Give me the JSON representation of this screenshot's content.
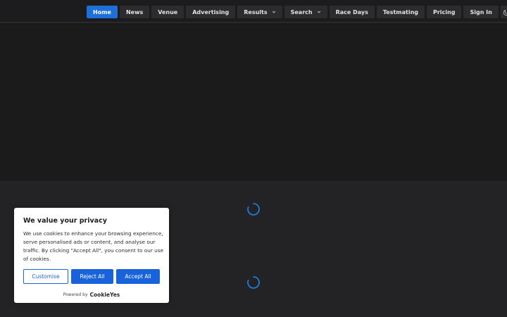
{
  "nav": {
    "items": [
      {
        "label": "Home",
        "active": true
      },
      {
        "label": "News"
      },
      {
        "label": "Venue"
      },
      {
        "label": "Advertising"
      },
      {
        "label": "Results",
        "dropdown": true
      },
      {
        "label": "Search",
        "dropdown": true
      },
      {
        "label": "Race Days"
      },
      {
        "label": "Testmating"
      },
      {
        "label": "Pricing"
      },
      {
        "label": "Sign In"
      }
    ],
    "theme_toggle_icon": "moon-icon",
    "dropdown_icon": "chevron-down-icon"
  },
  "loaders": {
    "icon": "spinner-icon",
    "color": "#1e7be0"
  },
  "cookie": {
    "title": "We value your privacy",
    "body": "We use cookies to enhance your browsing experience, serve personalised ads or content, and analyse our traffic. By clicking \"Accept All\", you consent to our use of cookies.",
    "customise_label": "Customise",
    "reject_label": "Reject All",
    "accept_label": "Accept All",
    "powered_by": "Powered by",
    "brand": "CookieYes"
  },
  "colors": {
    "accent": "#1e6fd9",
    "cookie_button": "#1863dc",
    "nav_bg": "#1c1c1e",
    "hero_bg": "#1b1b1c",
    "page_bg": "#232325"
  }
}
